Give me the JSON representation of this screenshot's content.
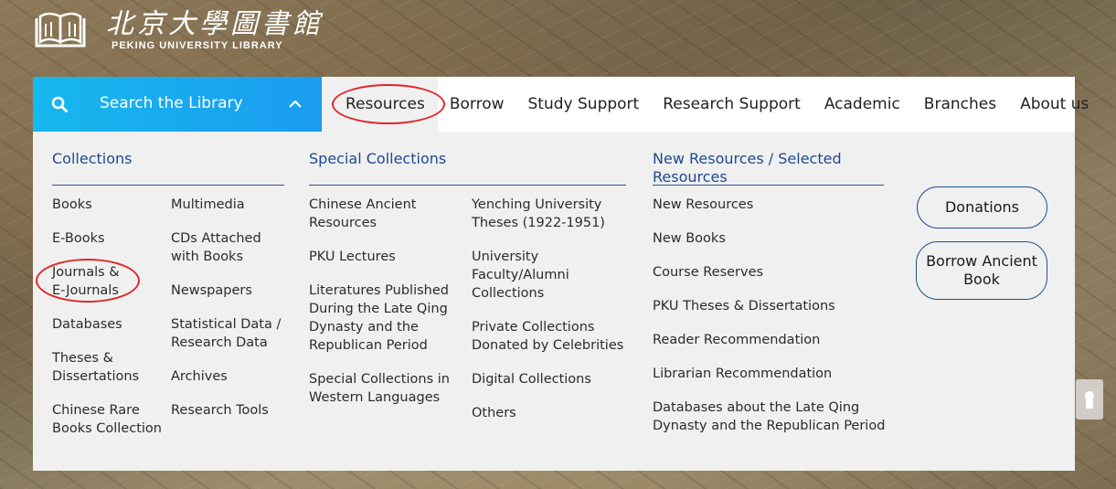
{
  "logo": {
    "cn_name": "北京大學圖書館",
    "en_name": "PEKING UNIVERSITY LIBRARY"
  },
  "search": {
    "label": "Search the Library",
    "icon": "search-icon",
    "toggle_icon": "chevron-up-icon"
  },
  "nav": {
    "items": [
      {
        "label": "Resources",
        "active": true
      },
      {
        "label": "Borrow"
      },
      {
        "label": "Study Support"
      },
      {
        "label": "Research Support"
      },
      {
        "label": "Academic"
      },
      {
        "label": "Branches"
      },
      {
        "label": "About us"
      }
    ]
  },
  "collections": {
    "title": "Collections",
    "col1": [
      "Books",
      "E-Books",
      "Journals &\nE-Journals",
      "Databases",
      "Theses &\nDissertations",
      "Chinese Rare\nBooks Collection"
    ],
    "col2": [
      "Multimedia",
      "CDs Attached\nwith Books",
      "Newspapers",
      "Statistical Data /\nResearch Data",
      "Archives",
      "Research Tools"
    ]
  },
  "special": {
    "title": "Special Collections",
    "col1": [
      "Chinese Ancient\nResources",
      "PKU Lectures",
      "Literatures Published\nDuring the Late Qing\nDynasty and the\nRepublican Period",
      "Special Collections in\nWestern Languages"
    ],
    "col2": [
      "Yenching University\nTheses (1922-1951)",
      "University\nFaculty/Alumni\nCollections",
      "Private Collections\nDonated by Celebrities",
      "Digital Collections",
      "Others"
    ]
  },
  "new_resources": {
    "title": "New Resources / Selected\nResources",
    "items": [
      "New Resources",
      "New Books",
      "Course Reserves",
      "PKU Theses & Dissertations",
      "Reader Recommendation",
      "Librarian Recommendation",
      "Databases about the Late Qing\nDynasty and the Republican Period"
    ]
  },
  "buttons": {
    "donations": "Donations",
    "borrow_ancient": "Borrow Ancient\nBook"
  },
  "colors": {
    "accent_blue": "#1b9cf0",
    "link_blue": "#1e4a8f",
    "highlight_red": "#e0262a"
  }
}
